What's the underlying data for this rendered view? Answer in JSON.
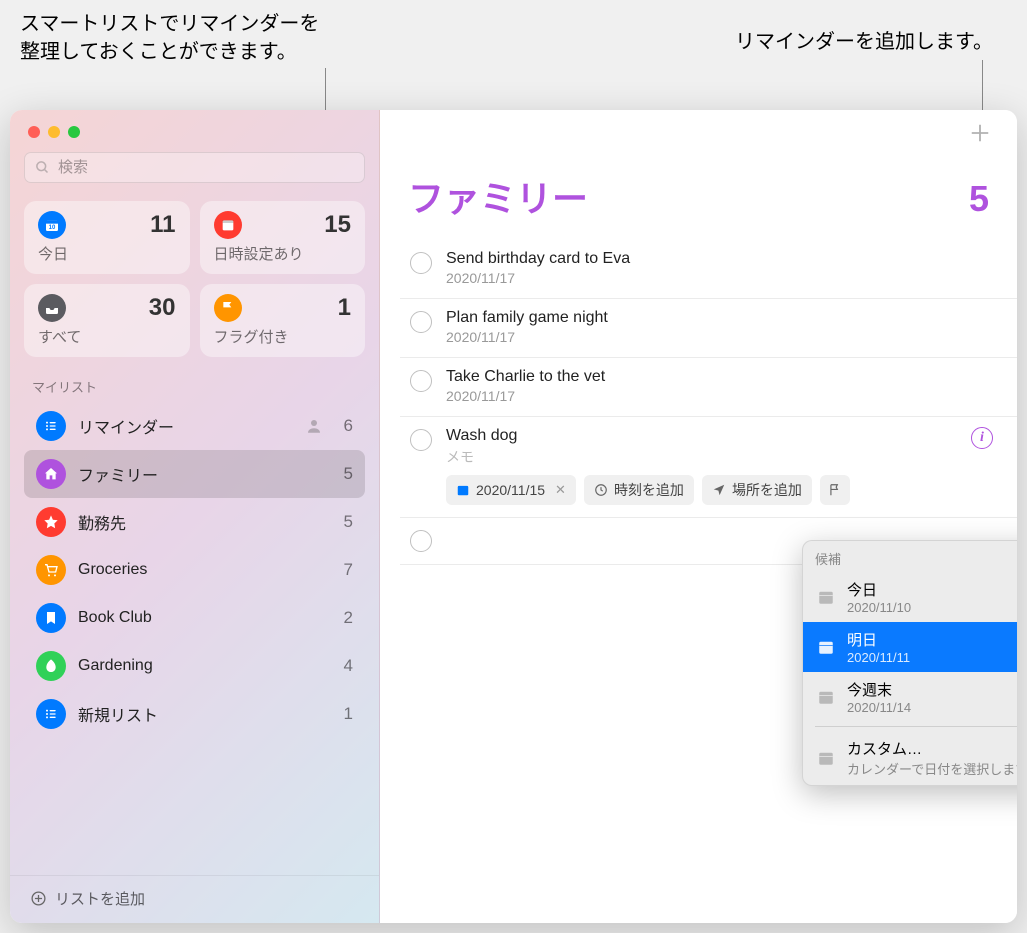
{
  "annotations": {
    "left_line1": "スマートリストでリマインダーを",
    "left_line2": "整理しておくことができます。",
    "right": "リマインダーを追加します。"
  },
  "sidebar": {
    "search_placeholder": "検索",
    "smart": {
      "today": {
        "label": "今日",
        "count": "11"
      },
      "scheduled": {
        "label": "日時設定あり",
        "count": "15"
      },
      "all": {
        "label": "すべて",
        "count": "30"
      },
      "flagged": {
        "label": "フラグ付き",
        "count": "1"
      }
    },
    "mylist_label": "マイリスト",
    "lists": [
      {
        "name": "リマインダー",
        "count": "6",
        "shared": true,
        "color": "li-reminders",
        "icon": "list"
      },
      {
        "name": "ファミリー",
        "count": "5",
        "shared": false,
        "color": "li-family",
        "icon": "home",
        "selected": true
      },
      {
        "name": "勤務先",
        "count": "5",
        "shared": false,
        "color": "li-work",
        "icon": "star"
      },
      {
        "name": "Groceries",
        "count": "7",
        "shared": false,
        "color": "li-groceries",
        "icon": "cart"
      },
      {
        "name": "Book Club",
        "count": "2",
        "shared": false,
        "color": "li-book",
        "icon": "bookmark"
      },
      {
        "name": "Gardening",
        "count": "4",
        "shared": false,
        "color": "li-garden",
        "icon": "leaf"
      },
      {
        "name": "新規リスト",
        "count": "1",
        "shared": false,
        "color": "li-new",
        "icon": "list"
      }
    ],
    "add_list": "リストを追加"
  },
  "main": {
    "title": "ファミリー",
    "count": "5",
    "reminders": [
      {
        "title": "Send birthday card to Eva",
        "date": "2020/11/17"
      },
      {
        "title": "Plan family game night",
        "date": "2020/11/17"
      },
      {
        "title": "Take Charlie to the vet",
        "date": "2020/11/17"
      },
      {
        "title": "Wash dog",
        "memo": "メモ",
        "editing": true
      }
    ],
    "actions": {
      "date_value": "2020/11/15",
      "add_time": "時刻を追加",
      "add_location": "場所を追加"
    },
    "suggestions": {
      "header": "候補",
      "items": [
        {
          "main": "今日",
          "sub": "2020/11/10"
        },
        {
          "main": "明日",
          "sub": "2020/11/11",
          "selected": true
        },
        {
          "main": "今週末",
          "sub": "2020/11/14"
        }
      ],
      "custom_main": "カスタム…",
      "custom_sub": "カレンダーで日付を選択します"
    }
  }
}
